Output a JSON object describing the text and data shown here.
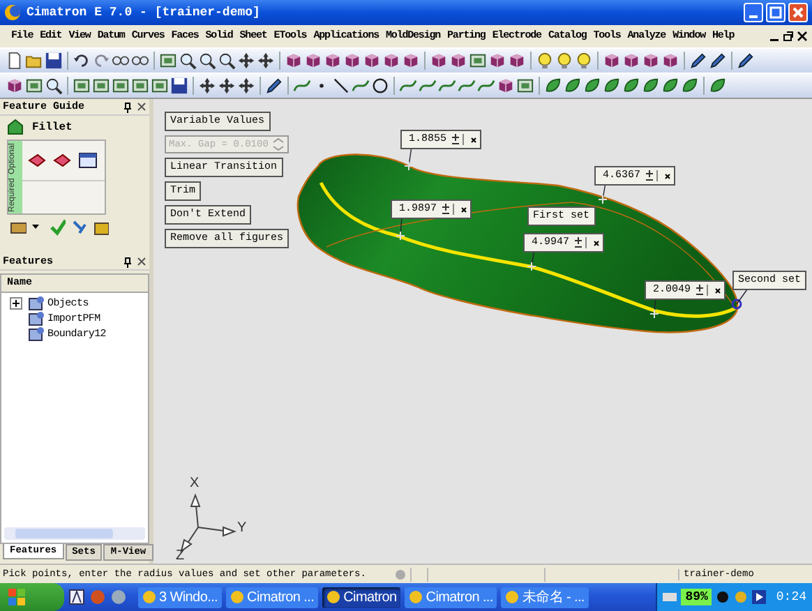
{
  "window": {
    "title": "Cimatron E 7.0 - [trainer-demo]"
  },
  "menu": [
    "File",
    "Edit",
    "View",
    "Datum",
    "Curves",
    "Faces",
    "Solid",
    "Sheet",
    "ETools",
    "Applications",
    "MoldDesign",
    "Parting",
    "Electrode",
    "Catalog",
    "Tools",
    "Analyze",
    "Window",
    "Help"
  ],
  "feature_guide": {
    "title": "Feature Guide",
    "feature": "Fillet",
    "sections": [
      "Required",
      "Optional"
    ]
  },
  "features_panel": {
    "title": "Features",
    "column": "Name",
    "items": [
      {
        "label": "Objects",
        "expanded": false
      },
      {
        "label": "ImportPFM"
      },
      {
        "label": "Boundary12"
      }
    ],
    "tabs": [
      {
        "label": "Features",
        "selected": true
      },
      {
        "label": "Sets",
        "selected": false
      },
      {
        "label": "M-View",
        "selected": false
      }
    ]
  },
  "options": [
    {
      "kind": "button",
      "label": "Variable Values"
    },
    {
      "kind": "field",
      "label": "Max. Gap = 0.0100",
      "disabled": true
    },
    {
      "kind": "button",
      "label": "Linear Transition"
    },
    {
      "kind": "button",
      "label": "Trim"
    },
    {
      "kind": "button",
      "label": "Don't Extend"
    },
    {
      "kind": "button",
      "label": "Remove all figures"
    }
  ],
  "radius_values": [
    "1.8855",
    "4.6367",
    "1.9897",
    "4.9947",
    "2.0049"
  ],
  "set_labels": [
    "First set",
    "Second set"
  ],
  "axes": [
    "X",
    "Y",
    "Z"
  ],
  "status_bar": {
    "message": "Pick points, enter the radius values and set other parameters.",
    "model": "trainer-demo"
  },
  "taskbar": {
    "tasks": [
      {
        "label": "3 Windo...",
        "selected": false
      },
      {
        "label": "Cimatron ...",
        "selected": false
      },
      {
        "label": "Cimatron",
        "selected": true
      },
      {
        "label": "Cimatron ...",
        "selected": false
      },
      {
        "label": "未命名 - ...",
        "selected": false
      }
    ],
    "battery": "89%",
    "clock": "0:24"
  }
}
